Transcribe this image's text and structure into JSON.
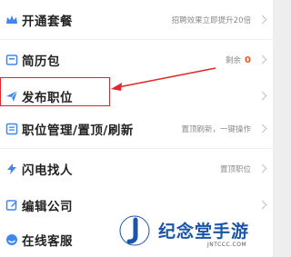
{
  "menu": {
    "items": [
      {
        "label": "开通套餐",
        "right_text": "招聘效果立即提升20倍",
        "icon": "crown-icon"
      },
      {
        "label": "简历包",
        "right_text": "剩余",
        "count": "0",
        "icon": "resume-pack-icon"
      },
      {
        "label": "发布职位",
        "right_text": "",
        "icon": "paper-plane-icon"
      },
      {
        "label": "职位管理/置顶/刷新",
        "right_text": "置顶刷新，一键操作",
        "icon": "list-icon"
      },
      {
        "label": "闪电找人",
        "right_text": "置顶职位",
        "icon": "lightning-icon"
      },
      {
        "label": "编辑公司",
        "right_text": "",
        "icon": "edit-icon"
      },
      {
        "label": "在线客服",
        "right_text": "",
        "icon": "support-icon"
      }
    ]
  },
  "watermark": {
    "brand": "纪念堂手游",
    "url": "JNTCCC.COM"
  },
  "colors": {
    "accent": "#3f86f0",
    "highlight": "#e3262b",
    "count": "#f0541e"
  }
}
